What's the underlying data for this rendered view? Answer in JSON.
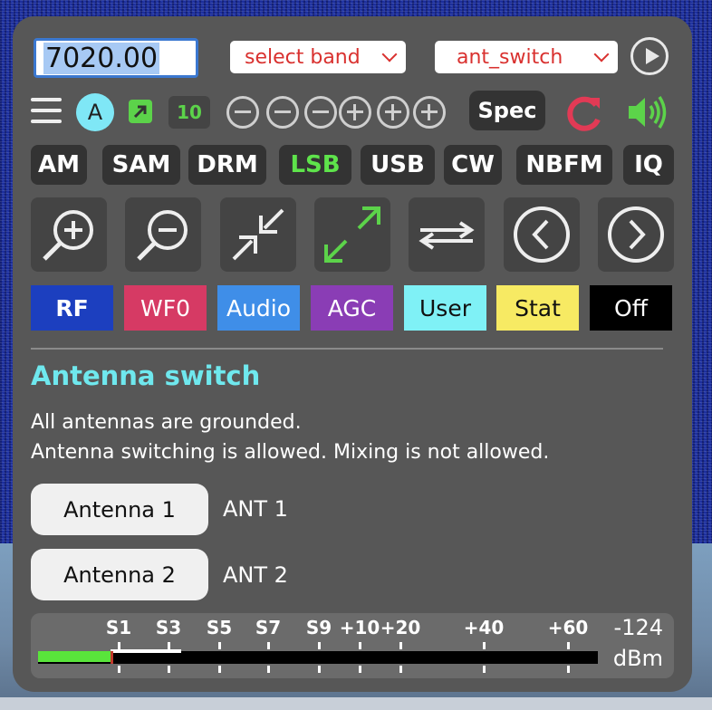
{
  "toolbar": {
    "frequency": "7020.00",
    "band_select": "select band",
    "ext_select": "ant_switch",
    "step_badge": "A",
    "ten_label": "10",
    "spec_label": "Spec"
  },
  "modes": [
    "AM",
    "SAM",
    "DRM",
    "LSB",
    "USB",
    "CW",
    "NBFM",
    "IQ"
  ],
  "active_mode": "LSB",
  "tabs": [
    {
      "label": "RF",
      "bg": "#1c3fbf",
      "fg": "#ffffff",
      "bold": true
    },
    {
      "label": "WF0",
      "bg": "#d63a64",
      "fg": "#ffffff",
      "bold": false
    },
    {
      "label": "Audio",
      "bg": "#3f8ee8",
      "fg": "#ffffff",
      "bold": false
    },
    {
      "label": "AGC",
      "bg": "#8a3db5",
      "fg": "#ffffff",
      "bold": false
    },
    {
      "label": "User",
      "bg": "#7ff1f6",
      "fg": "#111111",
      "bold": false
    },
    {
      "label": "Stat",
      "bg": "#f7ea63",
      "fg": "#111111",
      "bold": false
    },
    {
      "label": "Off",
      "bg": "#000000",
      "fg": "#ffffff",
      "bold": false
    }
  ],
  "antenna": {
    "heading": "Antenna switch",
    "status_line1": "All antennas are grounded.",
    "status_line2": "Antenna switching is allowed. Mixing is not allowed.",
    "buttons": [
      {
        "label": "Antenna 1",
        "desc": "ANT 1"
      },
      {
        "label": "Antenna 2",
        "desc": "ANT 2"
      }
    ]
  },
  "smeter": {
    "labels": [
      "S1",
      "S3",
      "S5",
      "S7",
      "S9",
      "+10",
      "+20",
      "+40",
      "+60"
    ],
    "value": "-124",
    "unit": "dBm",
    "level_fraction": 0.13
  },
  "colors": {
    "accent": "#6fe8ee",
    "active_mode": "#5ee34b",
    "select_text": "#d9312f",
    "reload": "#e23a55",
    "speaker": "#5cd34a"
  },
  "icons": [
    "menu-icon",
    "popout-icon",
    "zoom-out-icon",
    "zoom-in-icon",
    "reload-icon",
    "speaker-icon",
    "magnify-plus-icon",
    "magnify-minus-icon",
    "shrink-arrows-icon",
    "expand-arrows-icon",
    "swap-arrows-icon",
    "chevron-left-icon",
    "chevron-right-icon",
    "play-icon"
  ]
}
